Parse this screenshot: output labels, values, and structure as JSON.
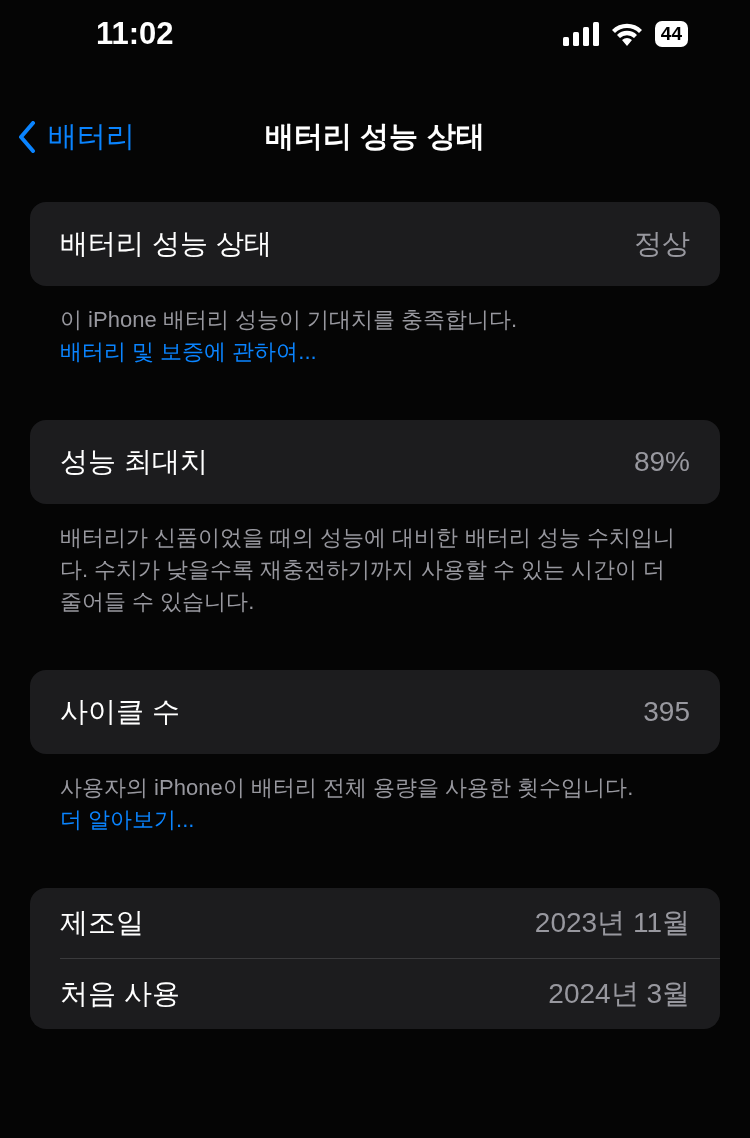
{
  "status_bar": {
    "time": "11:02",
    "battery": "44"
  },
  "nav": {
    "back": "배터리",
    "title": "배터리 성능 상태"
  },
  "sections": [
    {
      "rows": [
        {
          "label": "배터리 성능 상태",
          "value": "정상"
        }
      ],
      "footer": "이 iPhone 배터리 성능이 기대치를 충족합니다.",
      "link": "배터리 및 보증에 관하여..."
    },
    {
      "rows": [
        {
          "label": "성능 최대치",
          "value": "89%"
        }
      ],
      "footer": "배터리가 신품이었을 때의 성능에 대비한 배터리 성능 수치입니다. 수치가 낮을수록 재충전하기까지 사용할 수 있는 시간이 더 줄어들 수 있습니다."
    },
    {
      "rows": [
        {
          "label": "사이클 수",
          "value": "395"
        }
      ],
      "footer": "사용자의 iPhone이 배터리 전체 용량을 사용한 횟수입니다.",
      "link": "더 알아보기..."
    },
    {
      "rows": [
        {
          "label": "제조일",
          "value": "2023년 11월"
        },
        {
          "label": "처음 사용",
          "value": "2024년 3월"
        }
      ]
    }
  ]
}
